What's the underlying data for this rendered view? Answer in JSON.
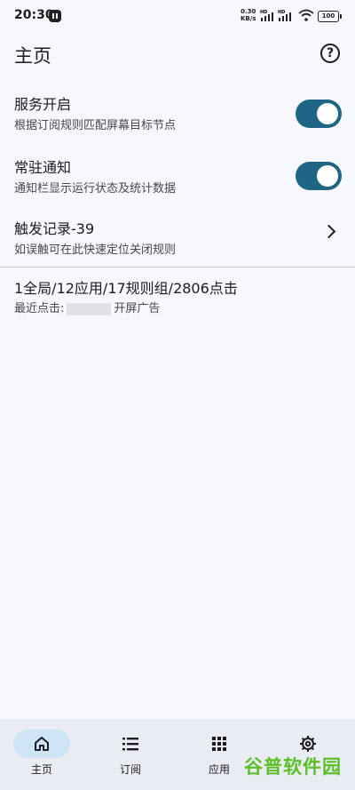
{
  "status_bar": {
    "time": "20:30",
    "net_speed": "0.30",
    "net_unit": "KB/s",
    "signal_1": "HD",
    "signal_2": "HD",
    "battery": "100"
  },
  "header": {
    "title": "主页",
    "help_icon": "help-circle-icon"
  },
  "settings": [
    {
      "title": "服务开启",
      "subtitle": "根据订阅规则匹配屏幕目标节点",
      "control": "switch",
      "on": true
    },
    {
      "title": "常驻通知",
      "subtitle": "通知栏显示运行状态及统计数据",
      "control": "switch",
      "on": true
    },
    {
      "title": "触发记录-39",
      "subtitle": "如误触可在此快速定位关闭规则",
      "control": "chevron-right-icon"
    }
  ],
  "stats": {
    "summary": "1全局/12应用/17规则组/2806点击",
    "recent_label": "最近点击:",
    "recent_value": "开屏广告"
  },
  "bottom_nav": [
    {
      "label": "主页",
      "icon": "home-icon",
      "active": true
    },
    {
      "label": "订阅",
      "icon": "list-icon",
      "active": false
    },
    {
      "label": "应用",
      "icon": "apps-grid-icon",
      "active": false
    },
    {
      "label": "",
      "icon": "settings-gear-icon",
      "active": false
    }
  ],
  "watermark": "谷普软件园",
  "colors": {
    "background": "#f6f8fd",
    "switch_on": "#1f6584",
    "nav_background": "#e9ecf2",
    "nav_active_pill": "#cde5f5",
    "watermark": "#5cbf2a"
  }
}
